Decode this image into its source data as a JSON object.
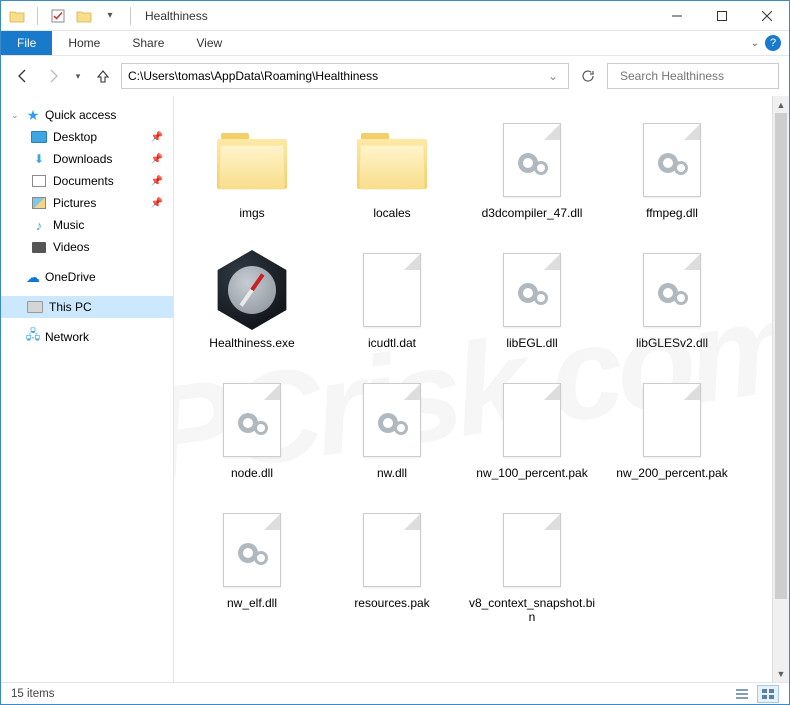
{
  "titlebar": {
    "title": "Healthiness"
  },
  "menubar": {
    "file": "File",
    "tabs": [
      "Home",
      "Share",
      "View"
    ]
  },
  "navbar": {
    "path": "C:\\Users\\tomas\\AppData\\Roaming\\Healthiness",
    "search_placeholder": "Search Healthiness"
  },
  "sidebar": {
    "quick_access": "Quick access",
    "items": [
      {
        "label": "Desktop",
        "pinned": true
      },
      {
        "label": "Downloads",
        "pinned": true
      },
      {
        "label": "Documents",
        "pinned": true
      },
      {
        "label": "Pictures",
        "pinned": true
      },
      {
        "label": "Music",
        "pinned": false
      },
      {
        "label": "Videos",
        "pinned": false
      }
    ],
    "onedrive": "OneDrive",
    "thispc": "This PC",
    "network": "Network"
  },
  "files": [
    {
      "name": "imgs",
      "type": "folder"
    },
    {
      "name": "locales",
      "type": "folder"
    },
    {
      "name": "d3dcompiler_47.dll",
      "type": "dll"
    },
    {
      "name": "ffmpeg.dll",
      "type": "dll"
    },
    {
      "name": "Healthiness.exe",
      "type": "exe"
    },
    {
      "name": "icudtl.dat",
      "type": "file"
    },
    {
      "name": "libEGL.dll",
      "type": "dll"
    },
    {
      "name": "libGLESv2.dll",
      "type": "dll"
    },
    {
      "name": "node.dll",
      "type": "dll"
    },
    {
      "name": "nw.dll",
      "type": "dll"
    },
    {
      "name": "nw_100_percent.pak",
      "type": "file"
    },
    {
      "name": "nw_200_percent.pak",
      "type": "file"
    },
    {
      "name": "nw_elf.dll",
      "type": "dll"
    },
    {
      "name": "resources.pak",
      "type": "file"
    },
    {
      "name": "v8_context_snapshot.bin",
      "type": "file"
    }
  ],
  "statusbar": {
    "count": "15 items"
  }
}
